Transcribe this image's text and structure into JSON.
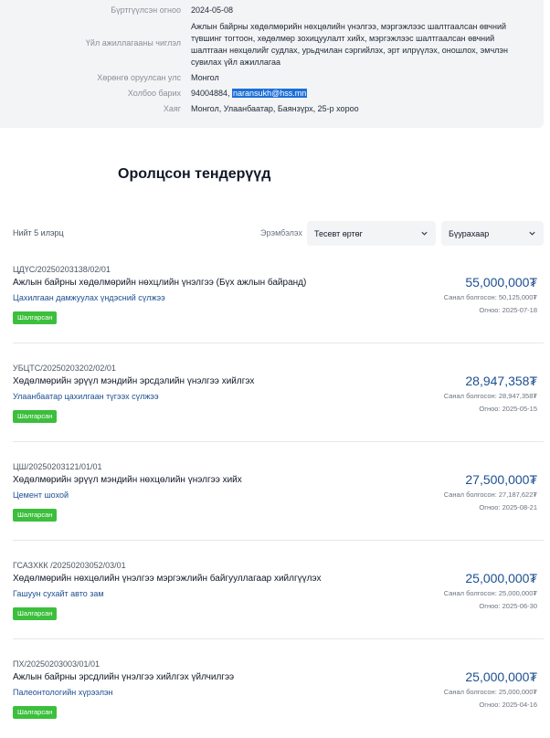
{
  "info": {
    "registered_label": "Бүртгүүлсэн огноо",
    "registered_value": "2024-05-08",
    "activity_label": "Үйл ажиллагааны чиглэл",
    "activity_value": "Ажлын байрны хөдөлмөрийн нөхцөлийн үнэлгээ, мэргэжлээс шалтгаалсан өвчний түвшинг тогтоон, хөдөлмөр зохицуулалт хийх, мэргэжлээс шалтгаалсан өвчний шалтгаан нөхцөлийг судлах, урьдчилан сэргийлэх, эрт илрүүлэх, оношлох, эмчлэн сувилах үйл ажиллагаа",
    "country_label": "Хөрөнгө оруулсан улс",
    "country_value": "Монгол",
    "contact_label": "Холбоо барих",
    "contact_phone": "94004884, ",
    "contact_email": "naransukh@hss.mn",
    "address_label": "Хаяг",
    "address_value": "Монгол, Улаанбаатар, Баянзүрх, 25-р хороо"
  },
  "section_title": "Оролцсон тендерүүд",
  "toolbar": {
    "count_text": "Нийт 5 илэрц",
    "sort_label": "Эрэмбэлэх",
    "sort_value": "Тесевт өртөг",
    "filter_value": "Бүурахаар"
  },
  "tenders": [
    {
      "code": "ЦДҮС/20250203138/02/01",
      "title": "Ажлын байрны хөдөлмөрийн нөхцлийн үнэлгээ (Бүх ажлын байранд)",
      "org": "Цахилгаан дамжуулах үндэсний сүлжээ",
      "badge": "Шалгарсан",
      "amount": "55,000,000₮",
      "offer": "Санал болгосон: 50,125,000₮",
      "date": "Огноо: 2025-07-18"
    },
    {
      "code": "УБЦТС/20250203202/02/01",
      "title": "Хөдөлмөрийн эрүүл мэндийн эрсдэлийн үнэлгээ хийлгэх",
      "org": "Улаанбаатар цахилгаан түгээх сүлжээ",
      "badge": "Шалгарсан",
      "amount": "28,947,358₮",
      "offer": "Санал болгосон: 28,947,358₮",
      "date": "Огноо: 2025-05-15"
    },
    {
      "code": "ЦШ/20250203121/01/01",
      "title": "Хөдөлмөрийн эрүүл мэндийн нөхцөлийн үнэлгээ хийх",
      "org": "Цемент шохой",
      "badge": "Шалгарсан",
      "amount": "27,500,000₮",
      "offer": "Санал болгосон: 27,187,622₮",
      "date": "Огноо: 2025-08-21"
    },
    {
      "code": "ГСАЗХКК /20250203052/03/01",
      "title": "Хөдөлмөрийн нөхцөлийн үнэлгээ мэргэжлийн байгууллагаар хийлгүүлэх",
      "org": "Гашуун сухайт авто зам",
      "badge": "Шалгарсан",
      "amount": "25,000,000₮",
      "offer": "Санал болгосон: 25,000,000₮",
      "date": "Огноо: 2025-06-30"
    },
    {
      "code": "ПХ/20250203003/01/01",
      "title": "Ажлын байрны эрсдлийн үнэлгээ хийлгэх үйлчилгээ",
      "org": "Палеонтологийн хүрээлэн",
      "badge": "Шалгарсан",
      "amount": "25,000,000₮",
      "offer": "Санал болгосон: 25,000,000₮",
      "date": "Огноо: 2025-04-16"
    }
  ]
}
